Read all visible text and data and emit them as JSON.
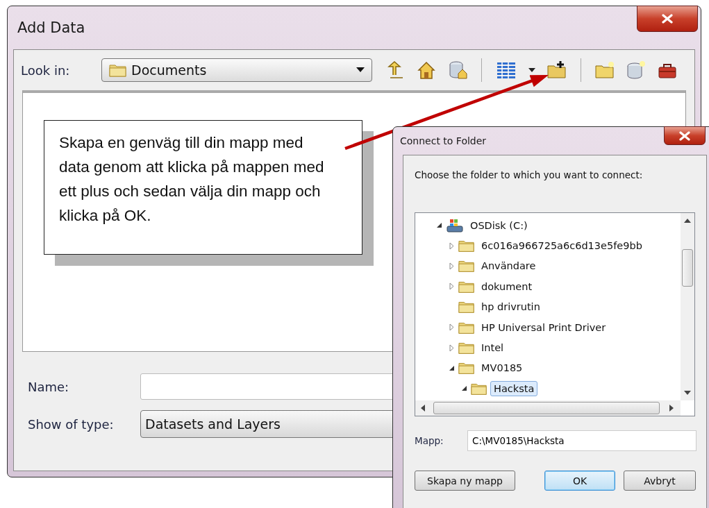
{
  "main_window": {
    "title": "Add Data",
    "look_in": {
      "label": "Look in:",
      "value": "Documents"
    },
    "name": {
      "label": "Name:"
    },
    "show_of_type": {
      "label": "Show of type:",
      "value": "Datasets and Layers"
    }
  },
  "callout": {
    "text": "Skapa en genväg till din mapp med data genom att klicka på mappen med ett plus och sedan välja din mapp och klicka på OK."
  },
  "dialog": {
    "title": "Connect to Folder",
    "prompt": "Choose the folder to which you want to connect:",
    "tree": [
      {
        "label": "OSDisk (C:)",
        "kind": "drive",
        "has_children": true,
        "expanded": true,
        "selected": false,
        "children": [
          {
            "label": "6c016a966725a6c6d13e5fe9bb",
            "kind": "folder",
            "has_children": true,
            "expanded": false,
            "selected": false
          },
          {
            "label": "Användare",
            "kind": "folder",
            "has_children": true,
            "expanded": false,
            "selected": false
          },
          {
            "label": "dokument",
            "kind": "folder",
            "has_children": true,
            "expanded": false,
            "selected": false
          },
          {
            "label": "hp drivrutin",
            "kind": "folder",
            "has_children": false,
            "expanded": false,
            "selected": false
          },
          {
            "label": "HP Universal Print Driver",
            "kind": "folder",
            "has_children": true,
            "expanded": false,
            "selected": false
          },
          {
            "label": "Intel",
            "kind": "folder",
            "has_children": true,
            "expanded": false,
            "selected": false
          },
          {
            "label": "MV0185",
            "kind": "folder",
            "has_children": true,
            "expanded": true,
            "selected": false,
            "children": [
              {
                "label": "Hacksta",
                "kind": "folder",
                "has_children": true,
                "expanded": true,
                "selected": true
              }
            ]
          }
        ]
      }
    ],
    "folder": {
      "label": "Mapp:",
      "value": "C:\\MV0185\\Hacksta"
    },
    "buttons": [
      {
        "label": "Skapa ny mapp",
        "default": false
      },
      {
        "label": "OK",
        "default": true
      },
      {
        "label": "Avbryt",
        "default": false
      }
    ]
  }
}
